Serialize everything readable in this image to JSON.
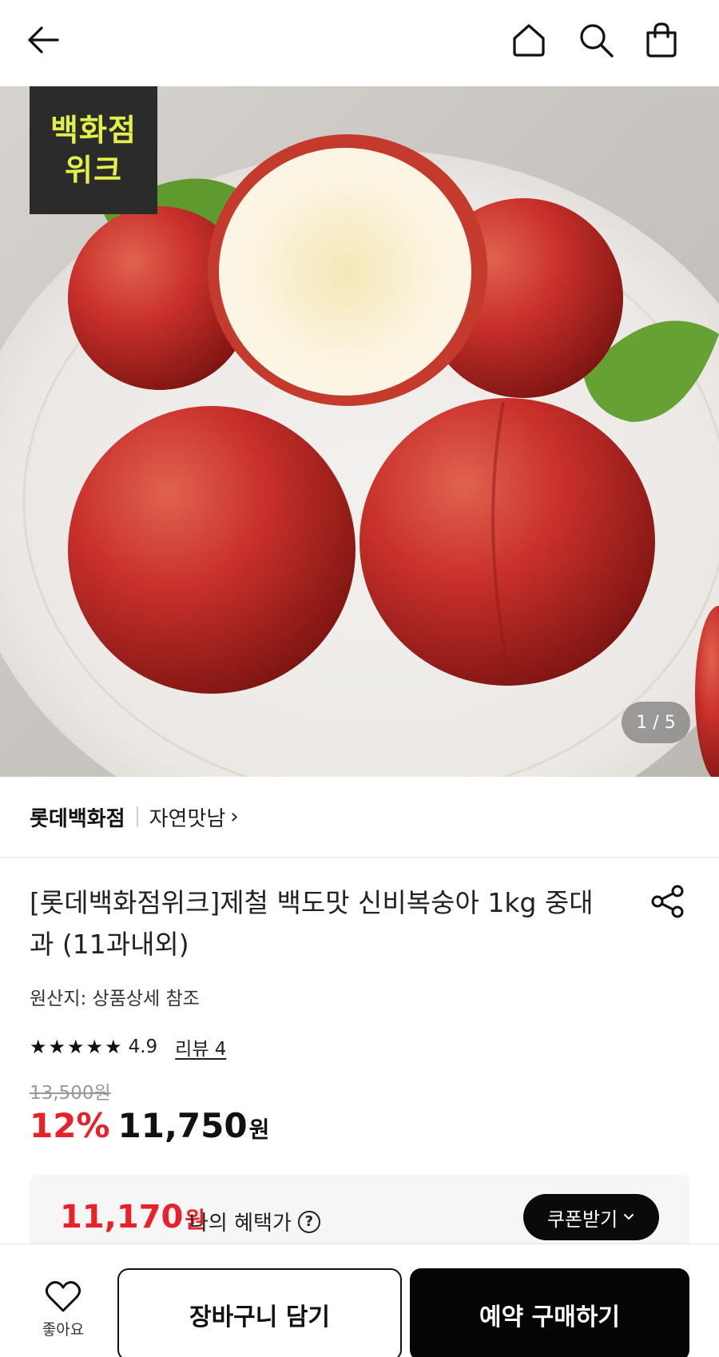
{
  "header": {
    "back_icon": "arrow-left-icon",
    "home_icon": "home-icon",
    "search_icon": "search-icon",
    "bag_icon": "shopping-bag-icon"
  },
  "hero": {
    "badge_line1": "백화점",
    "badge_line2": "위크",
    "counter": "1 / 5"
  },
  "brand": {
    "name": "롯데백화점",
    "store": "자연맛남",
    "store_chevron": "›"
  },
  "product": {
    "title": "[롯데백화점위크]제철 백도맛 신비복숭아 1kg 중대과 (11과내외)",
    "origin": "원산지: 상품상세 참조",
    "rating": {
      "stars": 5,
      "score": "4.9",
      "review_label": "리뷰 4"
    },
    "original_price": "13,500원",
    "discount": "12%",
    "price": "11,750",
    "currency": "원"
  },
  "benefit": {
    "price": "11,170",
    "currency": "원",
    "label": "나의 혜택가",
    "help_icon": "question-circle-icon",
    "coupon_label": "쿠폰받기",
    "coupon_chevron": "⌄"
  },
  "bottom": {
    "like_label": "좋아요",
    "cart_label": "장바구니 담기",
    "buy_label": "예약 구매하기"
  },
  "colors": {
    "accent_red": "#e8222b",
    "badge_bg": "#2b2b2b",
    "badge_text": "#e3f04a",
    "button_black": "#050505"
  }
}
